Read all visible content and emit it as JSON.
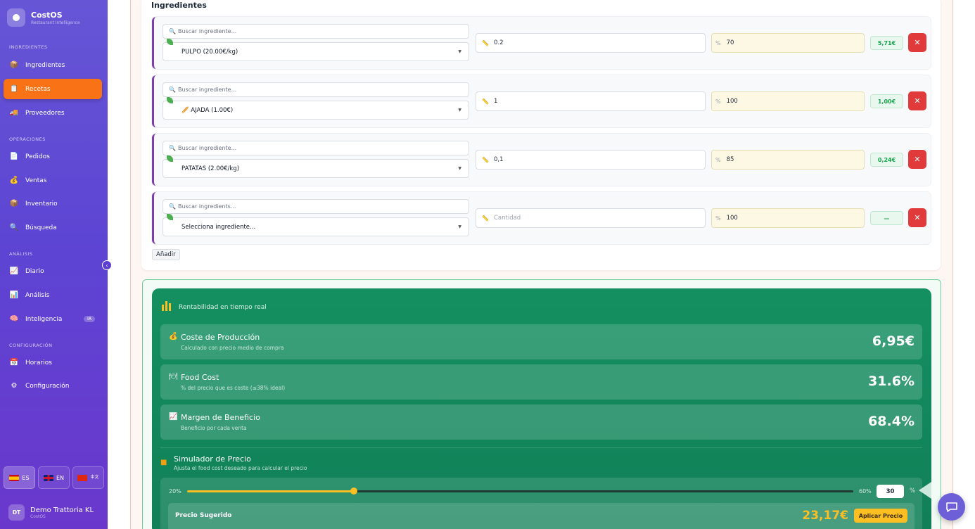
{
  "app": {
    "name": "CostOS",
    "tagline": "Restaurant Intelligence"
  },
  "sidebar": {
    "sections": [
      {
        "title": "INGREDIENTES"
      },
      {
        "title": "OPERACIONES"
      },
      {
        "title": "ANÁLISIS"
      },
      {
        "title": "CONFIGURACIÓN"
      }
    ],
    "items": [
      {
        "label": "Ingredientes",
        "icon": "box-icon"
      },
      {
        "label": "Recetas",
        "icon": "recipe-icon",
        "active": true
      },
      {
        "label": "Proveedores",
        "icon": "truck-icon"
      },
      {
        "label": "Pedidos",
        "icon": "clipboard-icon"
      },
      {
        "label": "Ventas",
        "icon": "money-bag-icon"
      },
      {
        "label": "Inventario",
        "icon": "box-icon"
      },
      {
        "label": "Búsqueda",
        "icon": "search-icon"
      },
      {
        "label": "Diario",
        "icon": "chart-up-icon"
      },
      {
        "label": "Análisis",
        "icon": "bar-chart-icon"
      },
      {
        "label": "Inteligencia",
        "icon": "brain-icon",
        "badge": "IA"
      },
      {
        "label": "Horarios",
        "icon": "calendar-icon"
      },
      {
        "label": "Configuración",
        "icon": "gear-icon"
      }
    ],
    "languages": [
      {
        "code": "ES",
        "active": true
      },
      {
        "code": "EN",
        "active": false
      },
      {
        "code": "中文",
        "active": false
      }
    ],
    "user": {
      "initials": "DT",
      "name": "Demo Trattoria KL",
      "subtitle": "CostOS"
    }
  },
  "ingredients": {
    "heading": "Ingredientes",
    "rows": [
      {
        "search_placeholder": "Buscar ingrediente...",
        "selected": "PULPO (20.00€/kg)",
        "quantity": "0.2",
        "percent": "70",
        "cost": "5,71€"
      },
      {
        "search_placeholder": "Buscar ingrediente...",
        "selected": "🥖 AJADA (1.00€)",
        "quantity": "1",
        "percent": "100",
        "cost": "1,00€"
      },
      {
        "search_placeholder": "Buscar ingrediente...",
        "selected": "PATATAS (2.00€/kg)",
        "quantity": "0,1",
        "percent": "85",
        "cost": "0,24€"
      },
      {
        "search_placeholder": "Buscar ingredients...",
        "selected": "Selecciona ingrediente...",
        "quantity": "",
        "quantity_placeholder": "Cantidad",
        "percent": "100",
        "cost": "—"
      }
    ],
    "add_label": "Añadir",
    "percent_symbol": "%"
  },
  "profitability": {
    "title": "Rentabilidad en tiempo real",
    "metrics": [
      {
        "icon": "money-bag-icon",
        "label": "Coste de Producción",
        "sub": "Calculado con precio medio de compra",
        "value": "6,95€"
      },
      {
        "icon": "plate-icon",
        "label": "Food Cost",
        "sub": "% del precio que es coste (≤38% ideal)",
        "value": "31.6%"
      },
      {
        "icon": "chart-up-icon",
        "label": "Margen de Beneficio",
        "sub": "Beneficio por cada venta",
        "value": "68.4%"
      }
    ],
    "simulator": {
      "title": "Simulador de Precio",
      "sub": "Ajusta el food cost deseado para calcular el precio",
      "min_label": "20%",
      "max_label": "60%",
      "value": "30",
      "value_fraction": 0.25,
      "unit": "%",
      "suggested_label": "Precio Sugerido",
      "suggested_value": "23,17€",
      "apply_label": "Aplicar Precio"
    }
  },
  "colors": {
    "sidebar": "#5d45d3",
    "active": "#f97316",
    "green": "#149060",
    "danger": "#e03a3a",
    "accent": "#fbbf24"
  }
}
